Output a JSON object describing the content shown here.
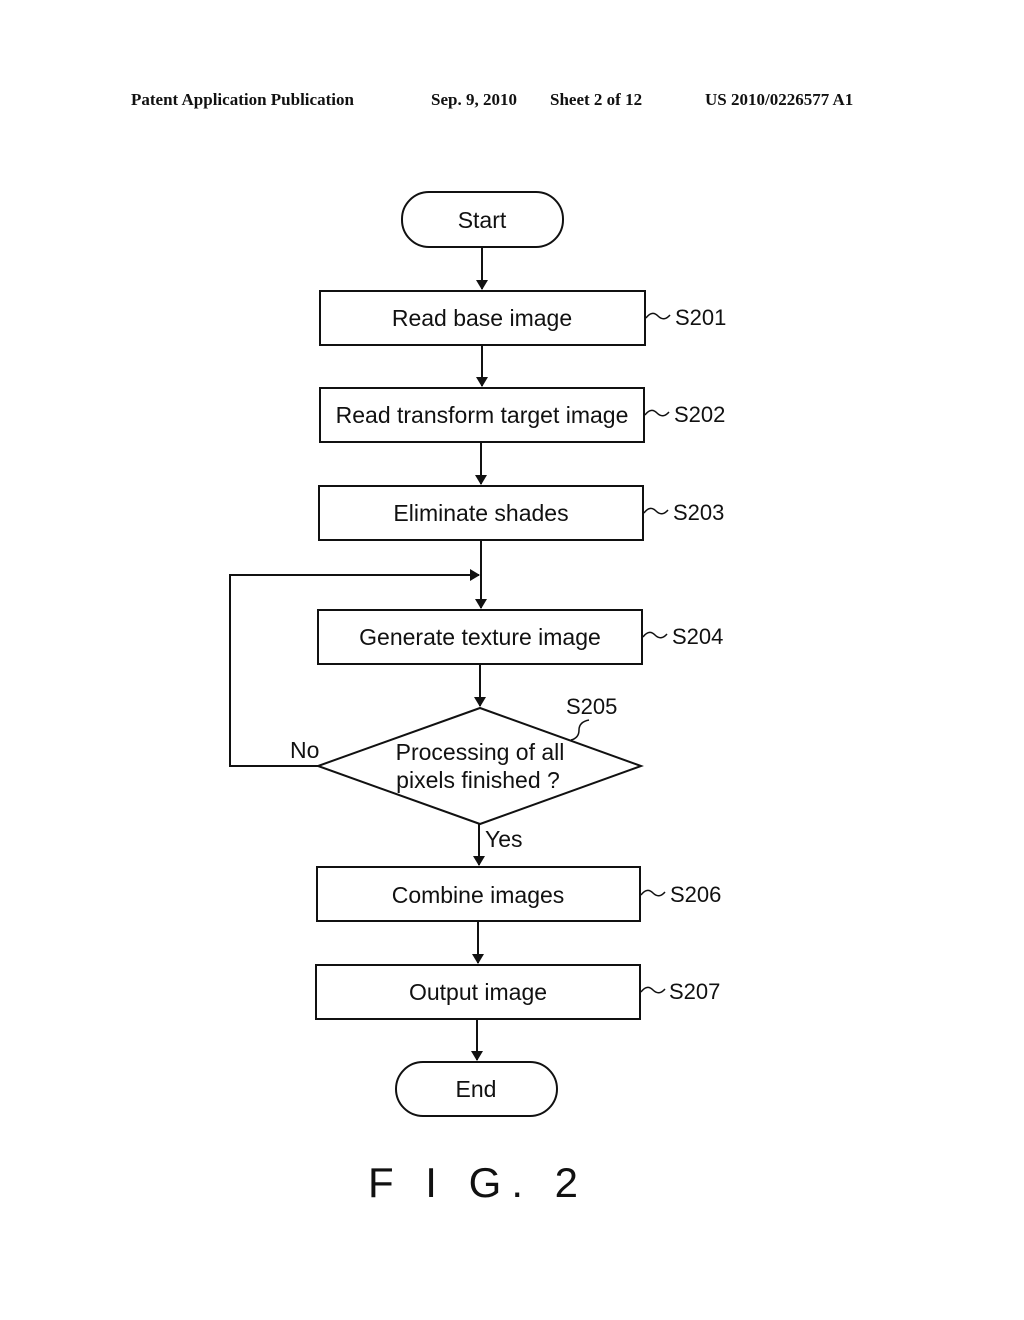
{
  "header": {
    "publication": "Patent Application Publication",
    "date": "Sep. 9, 2010",
    "sheet": "Sheet 2 of 12",
    "number": "US 2010/0226577 A1"
  },
  "flowchart": {
    "start": "Start",
    "end": "End",
    "steps": [
      {
        "id": "S201",
        "label": "Read base image"
      },
      {
        "id": "S202",
        "label": "Read transform target image"
      },
      {
        "id": "S203",
        "label": "Eliminate shades"
      },
      {
        "id": "S204",
        "label": "Generate texture image"
      },
      {
        "id": "S206",
        "label": "Combine images"
      },
      {
        "id": "S207",
        "label": "Output image"
      }
    ],
    "decision": {
      "id": "S205",
      "line1": "Processing of all",
      "line2": "pixels finished ?",
      "no_label": "No",
      "yes_label": "Yes"
    }
  },
  "figure_label": "F I G. 2"
}
